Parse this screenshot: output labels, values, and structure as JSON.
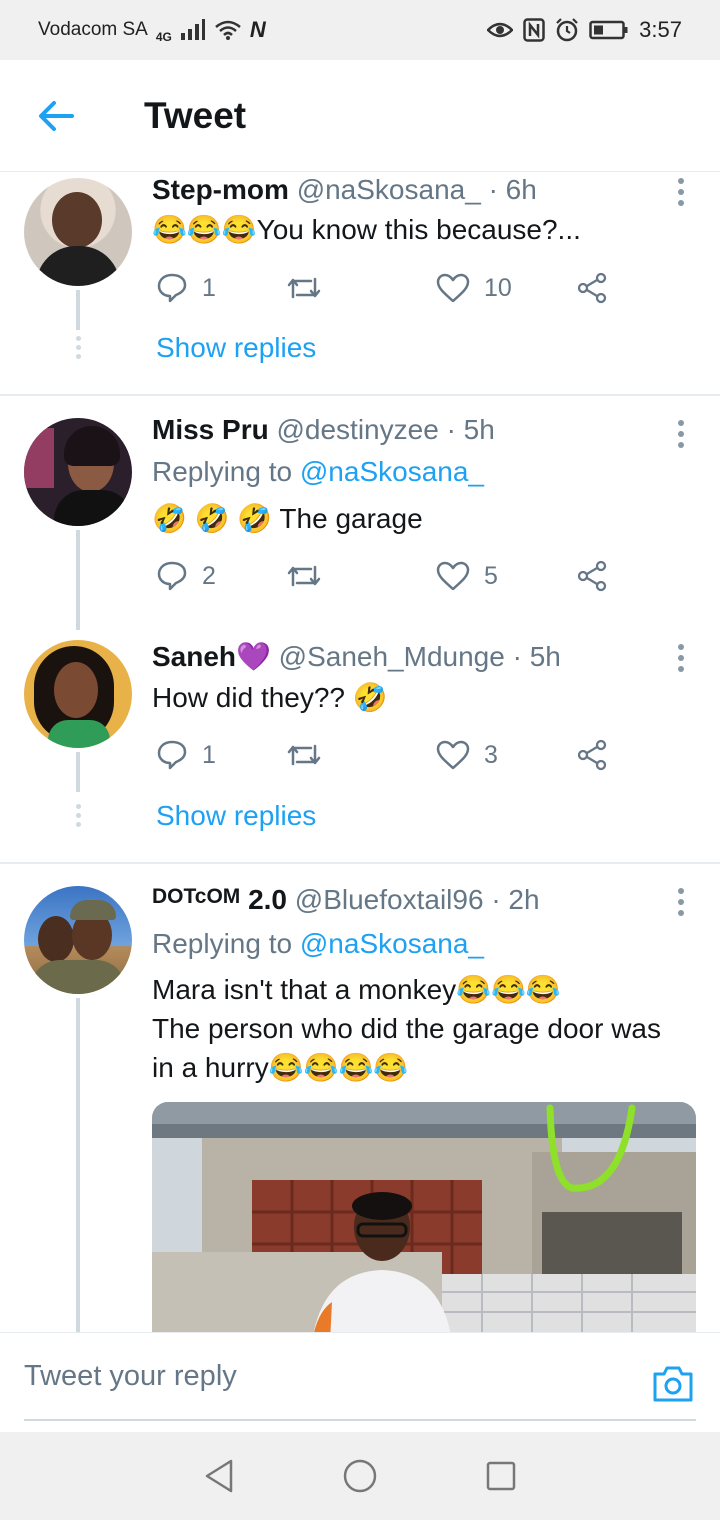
{
  "status": {
    "carrier": "Vodacom SA",
    "network": "4G",
    "time": "3:57"
  },
  "header": {
    "title": "Tweet"
  },
  "tweets": [
    {
      "name": "Step-mom",
      "handle": "@naSkosana_",
      "time": "· 6h",
      "text": "😂😂😂You know this because?...",
      "replies": "1",
      "retweets": "",
      "likes": "10",
      "show_replies": "Show replies"
    },
    {
      "name": "Miss Pru",
      "handle": "@destinyzee",
      "time": "· 5h",
      "replying_prefix": "Replying to",
      "replying_handle": "@naSkosana_",
      "text": "🤣 🤣 🤣 The garage",
      "replies": "2",
      "retweets": "",
      "likes": "5"
    },
    {
      "name": "Saneh💜",
      "handle": "@Saneh_Mdunge",
      "time": "· 5h",
      "text": "How did they?? 🤣",
      "replies": "1",
      "retweets": "",
      "likes": "3",
      "show_replies": "Show replies"
    },
    {
      "name_small": "DOTcOM",
      "name": "2.0",
      "handle": "@Bluefoxtail96",
      "time": "· 2h",
      "replying_prefix": "Replying to",
      "replying_handle": "@naSkosana_",
      "text_line1": "Mara isn't that a monkey😂😂😂",
      "text_line2": "The person who did the garage door was",
      "text_line3": "in a hurry😂😂😂😂"
    }
  ],
  "composer": {
    "placeholder": "Tweet your reply"
  },
  "icons": {
    "back": "arrow-left-icon",
    "reply": "comment-icon",
    "retweet": "retweet-icon",
    "like": "heart-icon",
    "share": "share-icon",
    "camera": "camera-icon"
  },
  "colors": {
    "accent": "#1da1f2",
    "muted": "#657786",
    "divider": "#e6ecf0"
  }
}
